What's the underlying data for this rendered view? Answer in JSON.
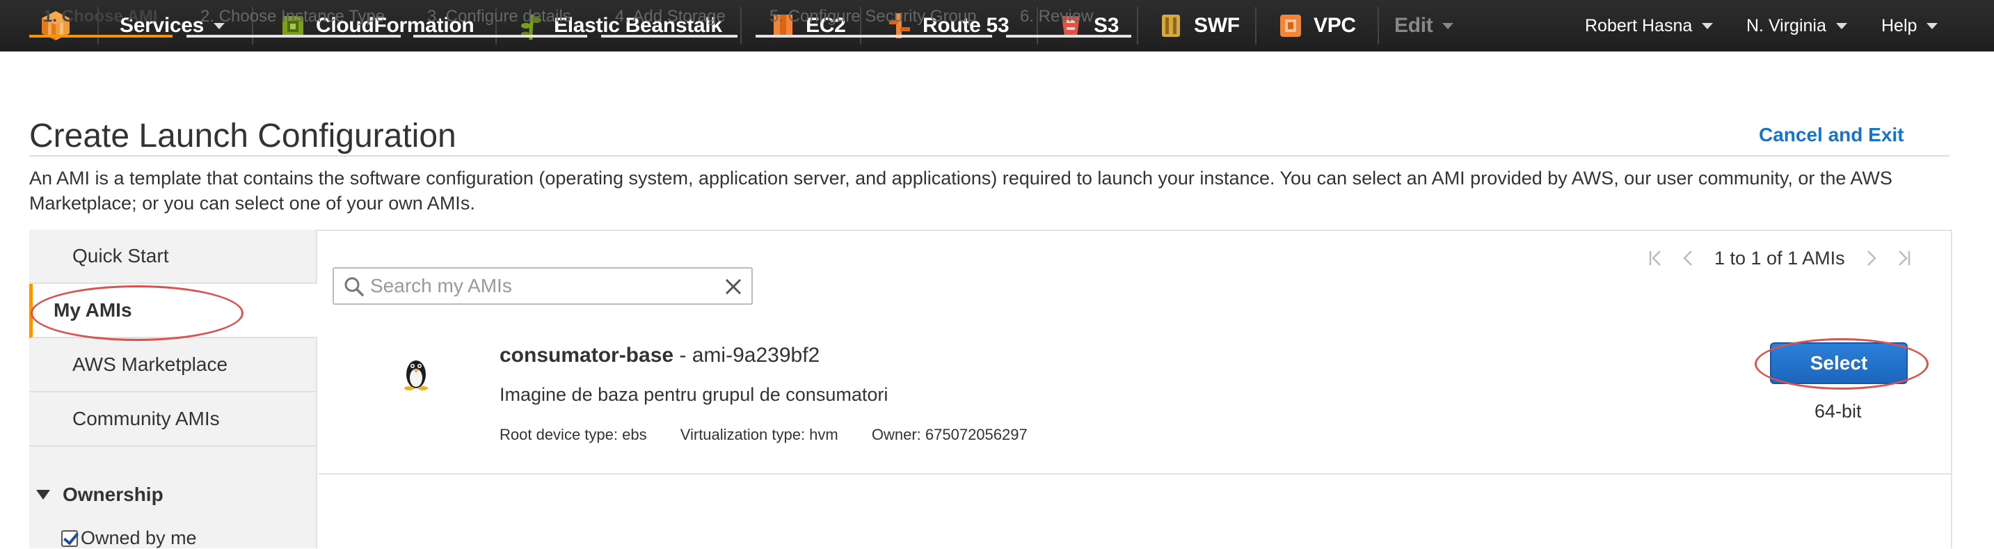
{
  "topbar": {
    "services_label": "Services",
    "services": [
      {
        "label": "CloudFormation",
        "icon": "cloudformation-icon",
        "color": "#7aa116"
      },
      {
        "label": "Elastic Beanstalk",
        "icon": "elastic-beanstalk-icon",
        "color": "#7aa116"
      },
      {
        "label": "EC2",
        "icon": "ec2-icon",
        "color": "#f58536"
      },
      {
        "label": "Route 53",
        "icon": "route53-icon",
        "color": "#f58536"
      },
      {
        "label": "S3",
        "icon": "s3-icon",
        "color": "#e05243"
      },
      {
        "label": "SWF",
        "icon": "swf-icon",
        "color": "#d9a741"
      },
      {
        "label": "VPC",
        "icon": "vpc-icon",
        "color": "#f58536"
      }
    ],
    "edit_label": "Edit",
    "user": "Robert Hasna",
    "region": "N. Virginia",
    "help": "Help"
  },
  "wizard": {
    "steps": [
      "1. Choose AMI",
      "2. Choose Instance Type",
      "3. Configure details",
      "4. Add Storage",
      "5. Configure Security Group",
      "6. Review"
    ],
    "active_step": 0
  },
  "page": {
    "title": "Create Launch Configuration",
    "cancel": "Cancel and Exit",
    "intro": "An AMI is a template that contains the software configuration (operating system, application server, and applications) required to launch your instance. You can select an AMI provided by AWS, our user community, or the AWS Marketplace; or you can select one of your own AMIs."
  },
  "sidebar": {
    "items": [
      "Quick Start",
      "My AMIs",
      "AWS Marketplace",
      "Community AMIs"
    ],
    "active_index": 1,
    "ownership_label": "Ownership",
    "owned_by_me_label": "Owned by me",
    "owned_by_me_checked": true
  },
  "search": {
    "placeholder": "Search my AMIs",
    "value": ""
  },
  "pager": {
    "text": "1 to 1 of 1 AMIs"
  },
  "result": {
    "name": "consumator-base",
    "separator": " - ",
    "ami_id": "ami-9a239bf2",
    "description": "Imagine de baza pentru grupul de consumatori",
    "root_device": "Root device type: ebs",
    "virtualization": "Virtualization type: hvm",
    "owner": "Owner: 675072056297",
    "select_label": "Select",
    "arch": "64-bit",
    "os_icon": "linux-penguin-icon"
  },
  "colors": {
    "accent_orange": "#f89406",
    "link_blue": "#1a73c8",
    "button_blue": "#1c66bd",
    "annotation_red": "#d9534f"
  }
}
